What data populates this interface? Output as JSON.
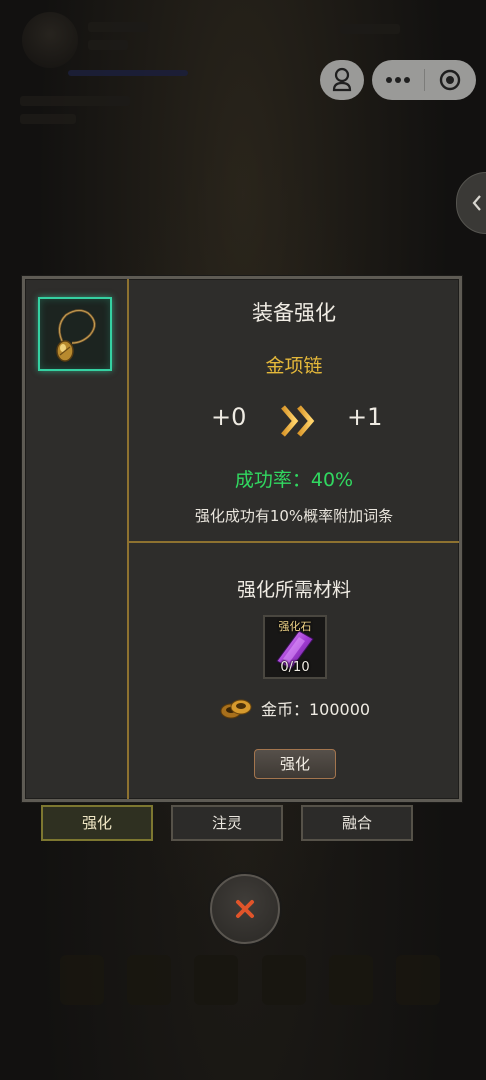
{
  "panel": {
    "title": "装备强化",
    "item_name": "金项链",
    "level_from": "+0",
    "level_to": "+1",
    "success_rate_label": "成功率：40%",
    "bonus_note": "强化成功有10%概率附加词条",
    "materials_title": "强化所需材料",
    "material": {
      "name": "强化石",
      "count": "0/10"
    },
    "gold_label": "金币：100000",
    "enhance_button": "强化"
  },
  "tabs": [
    {
      "label": "强化",
      "active": true
    },
    {
      "label": "注灵",
      "active": false
    },
    {
      "label": "融合",
      "active": false
    }
  ],
  "icons": {
    "item": "gold-necklace-icon",
    "material": "purple-crystal-icon",
    "gold": "gold-coins-icon",
    "arrows": "double-chevron-right-icon",
    "close": "close-x-icon"
  },
  "colors": {
    "item_name": "#e4b83a",
    "success_rate": "#31d860",
    "slot_border": "#35d1a2",
    "divider": "#8e7230",
    "close_x": "#e0542a"
  }
}
